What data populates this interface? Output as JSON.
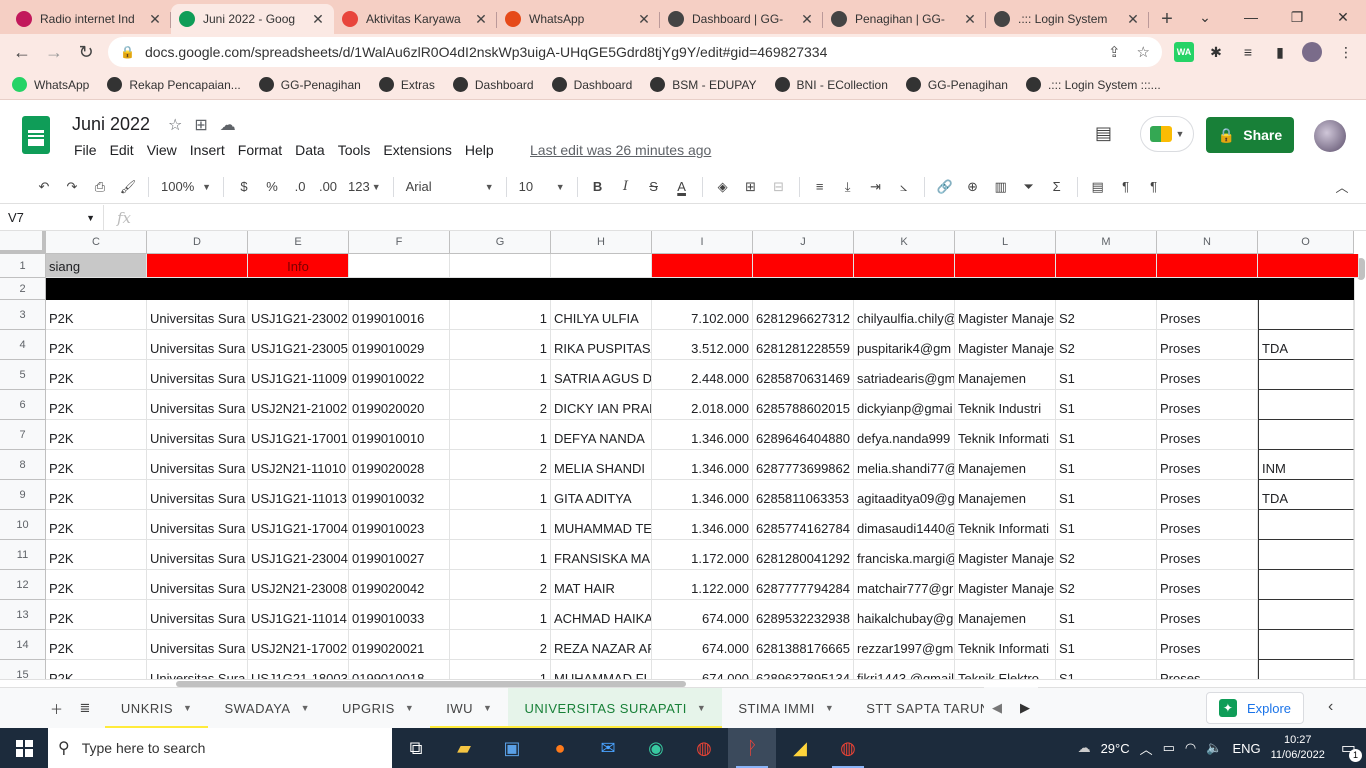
{
  "browser": {
    "tabs": [
      {
        "title": "Radio internet Ind",
        "color": "#c2185b"
      },
      {
        "title": "Juni 2022 - Goog",
        "color": "#0f9d58",
        "active": true
      },
      {
        "title": "Aktivitas Karyawa",
        "color": "#e8453c"
      },
      {
        "title": "WhatsApp",
        "color": "#e64a19"
      },
      {
        "title": "Dashboard | GG-",
        "color": "#444444"
      },
      {
        "title": "Penagihan | GG-",
        "color": "#444444"
      },
      {
        "title": ".::: Login System",
        "color": "#444444"
      }
    ],
    "url": "docs.google.com/spreadsheets/d/1WalAu6zlR0O4dI2nskWp3uigA-UHqGE5Gdrd8tjYg9Y/edit#gid=469827334",
    "bookmarks": [
      "WhatsApp",
      "Rekap Pencapaian...",
      "GG-Penagihan",
      "Extras",
      "Dashboard",
      "Dashboard",
      "BSM - EDUPAY",
      "BNI - ECollection",
      "GG-Penagihan",
      ".::: Login System :::..."
    ]
  },
  "doc": {
    "title": "Juni 2022",
    "menu": [
      "File",
      "Edit",
      "View",
      "Insert",
      "Format",
      "Data",
      "Tools",
      "Extensions",
      "Help"
    ],
    "last_edit": "Last edit was 26 minutes ago",
    "share_label": "Share"
  },
  "toolbar": {
    "zoom": "100%",
    "currency": "$",
    "percent": "%",
    "dec_dec": ".0",
    "dec_inc": ".00",
    "format_num": "123",
    "font": "Arial",
    "size": "10"
  },
  "formula": {
    "cell_ref": "V7",
    "fx": "fx"
  },
  "grid": {
    "columns": [
      "C",
      "D",
      "E",
      "F",
      "G",
      "H",
      "I",
      "J",
      "K",
      "L",
      "M",
      "N",
      "O"
    ],
    "row1": [
      "siang",
      "",
      "Info",
      "",
      "",
      "",
      "",
      "",
      "",
      "",
      "",
      "",
      ""
    ],
    "rows": [
      {
        "n": "3",
        "c": [
          "P2K",
          "Universitas  Sura",
          "USJ1G21-23002",
          "0199010016",
          "1",
          "CHILYA ULFIA",
          "7.102.000",
          "6281296627312",
          "chilyaulfia.chily@",
          "Magister Manaje",
          "S2",
          "Proses",
          ""
        ]
      },
      {
        "n": "4",
        "c": [
          "P2K",
          "Universitas  Sura",
          "USJ1G21-23005",
          "0199010029",
          "1",
          "RIKA PUSPITASA",
          "3.512.000",
          "6281281228559",
          "puspitarik4@gm",
          "Magister Manaje",
          "S2",
          "Proses",
          "TDA"
        ]
      },
      {
        "n": "5",
        "c": [
          "P2K",
          "Universitas  Sura",
          "USJ1G21-11009",
          "0199010022",
          "1",
          "SATRIA AGUS DE",
          "2.448.000",
          "6285870631469",
          "satriadearis@gm",
          "Manajemen",
          "S1",
          "Proses",
          ""
        ]
      },
      {
        "n": "6",
        "c": [
          "P2K",
          "Universitas  Sura",
          "USJ2N21-21002",
          "0199020020",
          "2",
          "DICKY IAN PRAN",
          "2.018.000",
          "6285788602015",
          "dickyianp@gmai",
          "Teknik Industri",
          "S1",
          "Proses",
          ""
        ]
      },
      {
        "n": "7",
        "c": [
          "P2K",
          "Universitas  Sura",
          "USJ1G21-17001",
          "0199010010",
          "1",
          "DEFYA NANDA",
          "1.346.000",
          "6289646404880",
          "defya.nanda999",
          "Teknik Informati",
          "S1",
          "Proses",
          ""
        ]
      },
      {
        "n": "8",
        "c": [
          "P2K",
          "Universitas  Sura",
          "USJ2N21-11010",
          "0199020028",
          "2",
          "MELIA SHANDI",
          "1.346.000",
          "6287773699862",
          "melia.shandi77@",
          "Manajemen",
          "S1",
          "Proses",
          "INM"
        ]
      },
      {
        "n": "9",
        "c": [
          "P2K",
          "Universitas  Sura",
          "USJ1G21-11013",
          "0199010032",
          "1",
          "GITA ADITYA",
          "1.346.000",
          "6285811063353",
          "agitaaditya09@g",
          "Manajemen",
          "S1",
          "Proses",
          "TDA"
        ]
      },
      {
        "n": "10",
        "c": [
          "P2K",
          "Universitas  Sura",
          "USJ1G21-17004",
          "0199010023",
          "1",
          "MUHAMMAD TE",
          "1.346.000",
          "6285774162784",
          "dimasaudi1440@",
          "Teknik Informati",
          "S1",
          "Proses",
          ""
        ]
      },
      {
        "n": "11",
        "c": [
          "P2K",
          "Universitas  Sura",
          "USJ1G21-23004",
          "0199010027",
          "1",
          "FRANSISKA MAR",
          "1.172.000",
          "6281280041292",
          "franciska.margi@",
          "Magister Manaje",
          "S2",
          "Proses",
          ""
        ]
      },
      {
        "n": "12",
        "c": [
          "P2K",
          "Universitas  Sura",
          "USJ2N21-23008",
          "0199020042",
          "2",
          "MAT HAIR",
          "1.122.000",
          "6287777794284",
          "matchair777@gr",
          "Magister Manaje",
          "S2",
          "Proses",
          ""
        ]
      },
      {
        "n": "13",
        "c": [
          "P2K",
          "Universitas  Sura",
          "USJ1G21-11014",
          "0199010033",
          "1",
          "ACHMAD HAIKA",
          "674.000",
          "6289532232938",
          "haikalchubay@g",
          "Manajemen",
          "S1",
          "Proses",
          ""
        ]
      },
      {
        "n": "14",
        "c": [
          "P2K",
          "Universitas  Sura",
          "USJ2N21-17002",
          "0199020021",
          "2",
          "REZA NAZAR ARI",
          "674.000",
          "6281388176665",
          "rezzar1997@gm",
          "Teknik Informati",
          "S1",
          "Proses",
          ""
        ]
      },
      {
        "n": "15",
        "c": [
          "P2K",
          "Universitas  Sura",
          "USJ1G21-18003",
          "0199010018",
          "1",
          "MUHAMMAD FI",
          "674.000",
          "6289637895134",
          "fikri1443.@gmail",
          "Teknik Elektro",
          "S1",
          "Proses",
          ""
        ]
      }
    ]
  },
  "sheet_tabs": [
    {
      "label": "UNKRIS",
      "underline": "#ffeb3b"
    },
    {
      "label": "SWADAYA",
      "underline": ""
    },
    {
      "label": "UPGRIS",
      "underline": ""
    },
    {
      "label": "IWU",
      "underline": "#ffeb3b"
    },
    {
      "label": "UNIVERSITAS  SURAPATI",
      "underline": "#ffeb3b",
      "active": true
    },
    {
      "label": "STIMA IMMI",
      "underline": ""
    },
    {
      "label": "STT SAPTA TARUNA",
      "underline": ""
    }
  ],
  "explore_label": "Explore",
  "taskbar": {
    "search_placeholder": "Type here to search",
    "weather": "29°C",
    "lang": "ENG",
    "time": "10:27",
    "date": "11/06/2022",
    "notif": "1"
  },
  "colors": {
    "header_red": "#ff0000",
    "header_black": "#000000",
    "header_gray": "#c8c8c8",
    "share_green": "#188038"
  }
}
